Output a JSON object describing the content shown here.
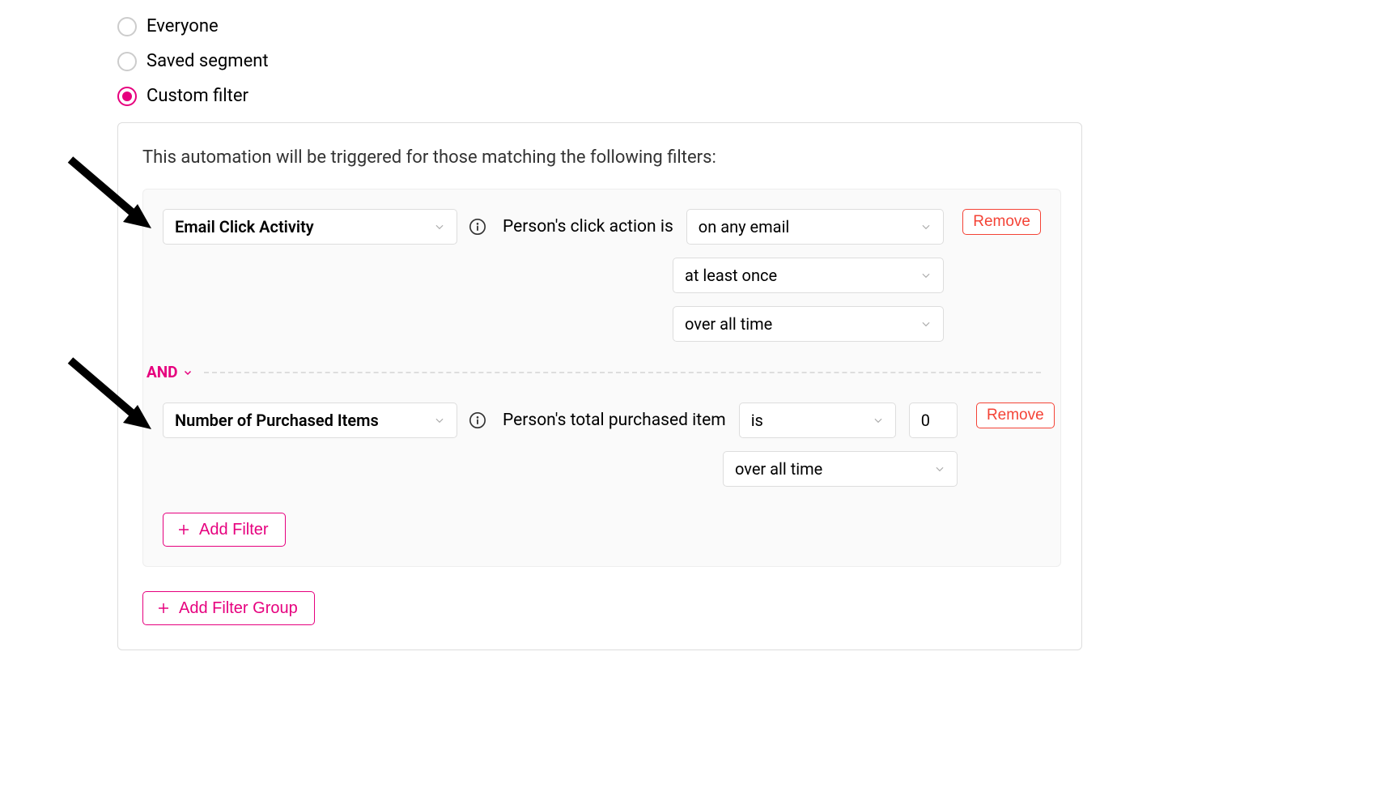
{
  "radio": {
    "everyone": "Everyone",
    "saved_segment": "Saved segment",
    "custom_filter": "Custom filter",
    "selected": "custom_filter"
  },
  "panel": {
    "intro": "This automation will be triggered for those matching the following filters:",
    "operator": "AND",
    "filters": [
      {
        "attribute": "Email Click Activity",
        "criteria_label": "Person's click action is",
        "criteria": [
          {
            "value": "on any email"
          },
          {
            "value": "at least once"
          },
          {
            "value": "over all time"
          }
        ],
        "remove_label": "Remove"
      },
      {
        "attribute": "Number of Purchased Items",
        "criteria_label": "Person's total purchased item",
        "criteria_inline": {
          "op": "is",
          "value": "0"
        },
        "criteria_after": [
          {
            "value": "over all time"
          }
        ],
        "remove_label": "Remove"
      }
    ],
    "add_filter_label": "Add Filter",
    "add_group_label": "Add Filter Group"
  }
}
